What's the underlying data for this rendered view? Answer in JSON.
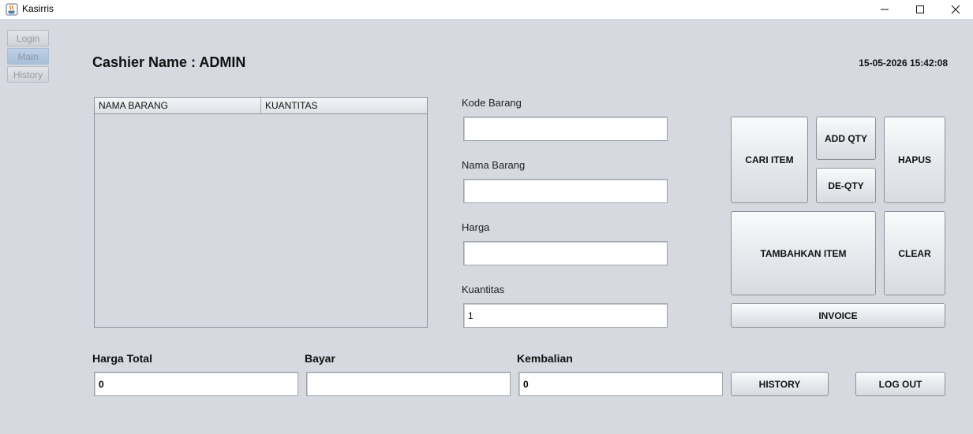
{
  "window": {
    "title": "Kasirris",
    "icon": "java-coffee-icon"
  },
  "sidebar": {
    "tabs": [
      {
        "label": "Login"
      },
      {
        "label": "Main"
      },
      {
        "label": "History"
      }
    ],
    "active_tab": "Main"
  },
  "header": {
    "cashier": "Cashier Name : ADMIN",
    "datetime": "15-05-2026 15:42:08"
  },
  "table": {
    "columns": [
      "NAMA BARANG",
      "KUANTITAS"
    ],
    "rows": []
  },
  "form": {
    "kode_label": "Kode Barang",
    "kode_value": "",
    "nama_label": "Nama Barang",
    "nama_value": "",
    "harga_label": "Harga",
    "harga_value": "",
    "kuantitas_label": "Kuantitas",
    "kuantitas_value": "1"
  },
  "buttons": {
    "cari": "CARI ITEM",
    "add_qty": "ADD QTY",
    "de_qty": "DE-QTY",
    "hapus": "HAPUS",
    "tambahkan": "TAMBAHKAN ITEM",
    "clear": "CLEAR",
    "invoice": "INVOICE",
    "history": "HISTORY",
    "logout": "LOG OUT"
  },
  "totals": {
    "harga_total_label": "Harga Total",
    "harga_total_value": "0",
    "bayar_label": "Bayar",
    "bayar_value": "",
    "kembalian_label": "Kembalian",
    "kembalian_value": "0"
  }
}
